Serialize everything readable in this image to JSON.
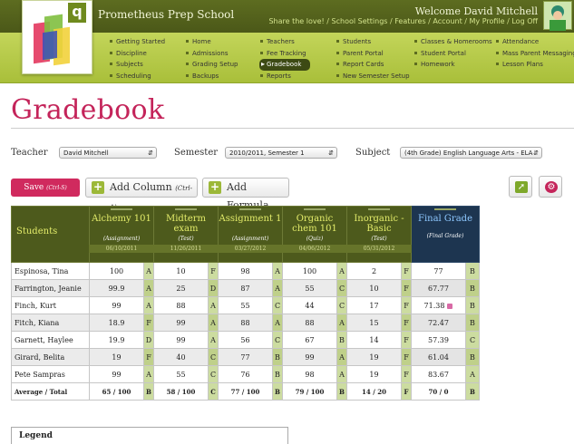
{
  "header": {
    "school_name": "Prometheus Prep School",
    "welcome": "Welcome David Mitchell",
    "top_links": [
      "Share the love!",
      "School Settings",
      "Features",
      "Account",
      "My Profile",
      "Log Off"
    ]
  },
  "nav": {
    "columns": [
      [
        "Getting Started",
        "Discipline",
        "Subjects",
        "Scheduling"
      ],
      [
        "Home",
        "Admissions",
        "Grading Setup",
        "Backups"
      ],
      [
        "Teachers",
        "Fee Tracking",
        "Gradebook",
        "Reports"
      ],
      [
        "Students",
        "Parent Portal",
        "Report Cards",
        "New Semester Setup"
      ],
      [
        "Classes & Homerooms",
        "Student Portal",
        "Homework"
      ],
      [
        "Attendance",
        "Mass Parent Messaging",
        "Lesson Plans"
      ]
    ],
    "active": "Gradebook"
  },
  "page": {
    "title": "Gradebook"
  },
  "filters": {
    "teacher_label": "Teacher",
    "teacher_value": "David Mitchell",
    "semester_label": "Semester",
    "semester_value": "2010/2011, Semester 1",
    "subject_label": "Subject",
    "subject_value": "(4th Grade) English Language Arts - ELA"
  },
  "toolbar": {
    "save_label": "Save",
    "save_shortcut": "(Ctrl-S)",
    "add_column_label": "Add Column",
    "add_column_shortcut": "(Ctrl-A)",
    "add_formula_label": "Add Formula"
  },
  "gradebook": {
    "students_header": "Students",
    "columns": [
      {
        "name": "Alchemy 101",
        "type": "(Assignment)",
        "date": "06/10/2011"
      },
      {
        "name": "Midterm exam",
        "type": "(Test)",
        "date": "11/26/2011"
      },
      {
        "name": "Assignment 1",
        "type": "(Assignment)",
        "date": "03/27/2012"
      },
      {
        "name": "Organic chem 101",
        "type": "(Quiz)",
        "date": "04/06/2012"
      },
      {
        "name": "Inorganic - Basic",
        "type": "(Test)",
        "date": "05/31/2012"
      }
    ],
    "final": {
      "name": "Final Grade",
      "type": "(Final Grade)"
    },
    "rows": [
      {
        "name": "Espinosa, Tina",
        "scores": [
          [
            "100",
            "A"
          ],
          [
            "10",
            "F"
          ],
          [
            "98",
            "A"
          ],
          [
            "100",
            "A"
          ],
          [
            "2",
            "F"
          ]
        ],
        "final": [
          "77",
          "B"
        ]
      },
      {
        "name": "Farrington, Jeanie",
        "scores": [
          [
            "99.9",
            "A"
          ],
          [
            "25",
            "D"
          ],
          [
            "87",
            "A"
          ],
          [
            "55",
            "C"
          ],
          [
            "10",
            "F"
          ]
        ],
        "final": [
          "67.77",
          "B"
        ]
      },
      {
        "name": "Finch, Kurt",
        "scores": [
          [
            "99",
            "A"
          ],
          [
            "88",
            "A"
          ],
          [
            "55",
            "C"
          ],
          [
            "44",
            "C"
          ],
          [
            "17",
            "F"
          ]
        ],
        "final": [
          "71.38",
          "B"
        ],
        "note": true
      },
      {
        "name": "Fitch, Kiana",
        "scores": [
          [
            "18.9",
            "F"
          ],
          [
            "99",
            "A"
          ],
          [
            "88",
            "A"
          ],
          [
            "88",
            "A"
          ],
          [
            "15",
            "F"
          ]
        ],
        "final": [
          "72.47",
          "B"
        ]
      },
      {
        "name": "Garnett, Haylee",
        "scores": [
          [
            "19.9",
            "D"
          ],
          [
            "99",
            "A"
          ],
          [
            "56",
            "C"
          ],
          [
            "67",
            "B"
          ],
          [
            "14",
            "F"
          ]
        ],
        "final": [
          "57.39",
          "C"
        ]
      },
      {
        "name": "Girard, Belita",
        "scores": [
          [
            "19",
            "F"
          ],
          [
            "40",
            "C"
          ],
          [
            "77",
            "B"
          ],
          [
            "99",
            "A"
          ],
          [
            "19",
            "F"
          ]
        ],
        "final": [
          "61.04",
          "B"
        ]
      },
      {
        "name": "Pete Sampras",
        "scores": [
          [
            "99",
            "A"
          ],
          [
            "55",
            "C"
          ],
          [
            "76",
            "B"
          ],
          [
            "98",
            "A"
          ],
          [
            "19",
            "F"
          ]
        ],
        "final": [
          "83.67",
          "A"
        ]
      }
    ],
    "average": {
      "label": "Average / Total",
      "scores": [
        [
          "65 / 100",
          "B"
        ],
        [
          "58 / 100",
          "C"
        ],
        [
          "77 / 100",
          "B"
        ],
        [
          "79 / 100",
          "B"
        ],
        [
          "14 / 20",
          "F"
        ]
      ],
      "final": [
        "70 / 0",
        "B"
      ]
    }
  },
  "legend": {
    "title": "Legend"
  },
  "colors": {
    "accent": "#c4245a",
    "header_dark": "#4d5a1c",
    "nav_green": "#b5c94a",
    "final_blue": "#1d3550"
  }
}
